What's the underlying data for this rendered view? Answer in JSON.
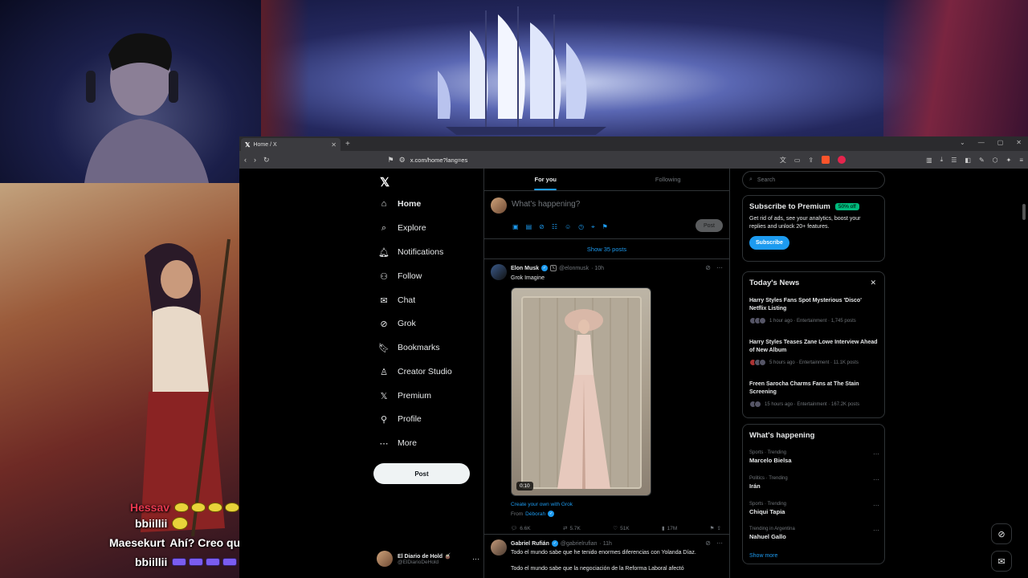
{
  "browser": {
    "tab_title": "Home / X",
    "url": "x.com/home?lang=es"
  },
  "nav": {
    "items": [
      {
        "label": "Home",
        "icon": "home-icon"
      },
      {
        "label": "Explore",
        "icon": "search-icon"
      },
      {
        "label": "Notifications",
        "icon": "bell-icon"
      },
      {
        "label": "Follow",
        "icon": "person-add-icon"
      },
      {
        "label": "Chat",
        "icon": "mail-icon"
      },
      {
        "label": "Grok",
        "icon": "grok-icon"
      },
      {
        "label": "Bookmarks",
        "icon": "bookmark-icon"
      },
      {
        "label": "Creator Studio",
        "icon": "creator-icon"
      },
      {
        "label": "Premium",
        "icon": "x-icon"
      },
      {
        "label": "Profile",
        "icon": "person-icon"
      },
      {
        "label": "More",
        "icon": "more-circle-icon"
      }
    ],
    "post_label": "Post",
    "account": {
      "name": "El Diario de Hold 🧉",
      "handle": "@ElDiarioDeHold"
    }
  },
  "feed": {
    "tabs": [
      "For you",
      "Following"
    ],
    "composer_placeholder": "What's happening?",
    "composer_post": "Post",
    "show_posts": "Show 35 posts",
    "tweet1": {
      "name": "Elon Musk",
      "handle": "@elonmusk",
      "time": "· 10h",
      "text": "Grok Imagine",
      "duration": "0:10",
      "grok_link": "Create your own with Grok",
      "from_label": "From",
      "from_name": "Déborah",
      "replies": "6.6K",
      "reposts": "5.7K",
      "likes": "51K",
      "views": "17M"
    },
    "tweet2": {
      "name": "Gabriel Rufián",
      "handle": "@gabrielrufian",
      "time": "· 11h",
      "text1": "Todo el mundo sabe que he tenido enormes diferencias con Yolanda Díaz.",
      "text2": "Todo el mundo sabe que la negociación de la Reforma Laboral afectó"
    }
  },
  "sidebar": {
    "search_placeholder": "Search",
    "premium": {
      "title": "Subscribe to Premium",
      "badge": "50% off",
      "text": "Get rid of ads, see your analytics, boost your replies and unlock 20+ features.",
      "button": "Subscribe"
    },
    "news": {
      "title": "Today's News",
      "items": [
        {
          "title": "Harry Styles Fans Spot Mysterious 'Disco' Netflix Listing",
          "meta": "1 hour ago · Entertainment · 1,745 posts"
        },
        {
          "title": "Harry Styles Teases Zane Lowe Interview Ahead of New Album",
          "meta": "5 hours ago · Entertainment · 11.1K posts"
        },
        {
          "title": "Freen Sarocha Charms Fans at The Stain Screening",
          "meta": "15 hours ago · Entertainment · 167.2K posts"
        }
      ]
    },
    "happening": {
      "title": "What's happening",
      "trends": [
        {
          "context": "Sports · Trending",
          "name": "Marcelo Bielsa"
        },
        {
          "context": "Politics · Trending",
          "name": "Irán"
        },
        {
          "context": "Sports · Trending",
          "name": "Chiqui Tapia"
        },
        {
          "context": "Trending in Argentina",
          "name": "Nahuel Gallo"
        }
      ],
      "show_more": "Show more"
    }
  },
  "stream_chat": {
    "lines": [
      {
        "user": "Hessav",
        "message": ""
      },
      {
        "user": "bbiillii",
        "message": ""
      },
      {
        "user": "Maesekurt",
        "message": "Ahí? Creo que te estoy siguiendo jeje"
      },
      {
        "user": "bbiillii",
        "message": ""
      }
    ],
    "colors": {
      "hessav": "#e8384f",
      "bbiillii": "#ffffff",
      "maesekurt": "#ffffff"
    }
  },
  "colors": {
    "accent": "#1d9bf0",
    "promo": "#00ba7c"
  }
}
